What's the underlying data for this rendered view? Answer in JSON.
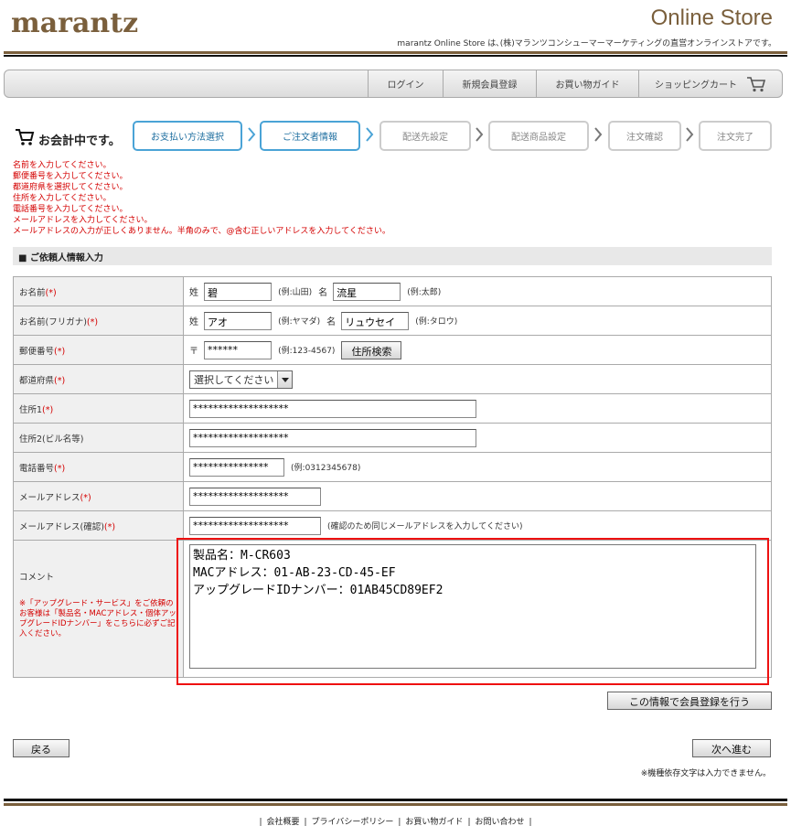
{
  "header": {
    "logo": "marantz",
    "store_title": "Online Store",
    "store_desc": "marantz Online Store は､(株)マランツコンシューマーマーケティングの直営オンラインストアです。"
  },
  "nav": {
    "login": "ログイン",
    "register": "新規会員登録",
    "guide": "お買い物ガイド",
    "cart": "ショッピングカート"
  },
  "checkout": {
    "label": "お会計中です。",
    "steps": [
      "お支払い方法選択",
      "ご注文者情報",
      "配送先設定",
      "配送商品設定",
      "注文確認",
      "注文完了"
    ]
  },
  "errors": [
    "名前を入力してください。",
    "郵便番号を入力してください。",
    "都道府県を選択してください。",
    "住所を入力してください。",
    "電話番号を入力してください。",
    "メールアドレスを入力してください。",
    "メールアドレスの入力が正しくありません。半角のみで、@含む正しいアドレスを入力してください。"
  ],
  "section_title": "■ ご依頼人情報入力",
  "form": {
    "required_mark": "(*)",
    "name": {
      "label": "お名前",
      "sei": "姓",
      "sei_value": "碧",
      "sei_ex": "(例:山田)",
      "mei": "名",
      "mei_value": "流星",
      "mei_ex": "(例:太郎)"
    },
    "kana": {
      "label": "お名前(フリガナ)",
      "sei": "姓",
      "sei_value": "アオ",
      "sei_ex": "(例:ヤマダ)",
      "mei": "名",
      "mei_value": "リュウセイ",
      "mei_ex": "(例:タロウ)"
    },
    "zip": {
      "label": "郵便番号",
      "mark": "〒",
      "value": "******",
      "ex": "(例:123-4567)",
      "button": "住所検索"
    },
    "pref": {
      "label": "都道府県",
      "selected": "選択してください"
    },
    "addr1": {
      "label": "住所1",
      "value": "*******************"
    },
    "addr2": {
      "label": "住所2(ビル名等)",
      "value": "*******************"
    },
    "tel": {
      "label": "電話番号",
      "value": "***************",
      "ex": "(例:0312345678)"
    },
    "email": {
      "label": "メールアドレス",
      "value": "*******************"
    },
    "email_confirm": {
      "label": "メールアドレス(確認)",
      "value": "*******************",
      "note": "(確認のため同じメールアドレスを入力してください)"
    },
    "comment": {
      "label": "コメント",
      "note": "※「アップグレード・サービス」をご依頼のお客様は「製品名・MACアドレス・個体アップグレードIDナンバー」をこちらに必ずご記入ください。",
      "value": "製品名：M-CR603\nMACアドレス：01-AB-23-CD-45-EF\nアップグレードIDナンバー：01AB45CD89EF2"
    }
  },
  "buttons": {
    "member_register": "この情報で会員登録を行う",
    "back": "戻る",
    "next": "次へ進む"
  },
  "bottom_note": "※機種依存文字は入力できません。",
  "footer": [
    "会社概要",
    "プライバシーポリシー",
    "お買い物ガイド",
    "お問い合わせ"
  ]
}
